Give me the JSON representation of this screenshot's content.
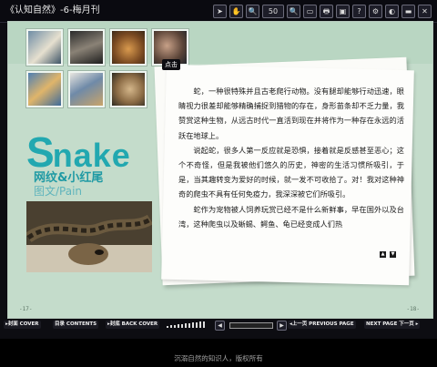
{
  "window": {
    "title": "《认知自然》-6-梅月刊"
  },
  "toolbar": {
    "zoom_label": "50"
  },
  "page": {
    "click_label": "点击",
    "heading_initial": "S",
    "heading_rest": "nake",
    "subtitle": "网纹&小红尾",
    "credit": "图文/Pain",
    "left_page_number": "-17-",
    "right_page_number": "-18-",
    "paragraphs": [
      "蛇，一种很特殊并且古老爬行动物。没有腿却能够行动迅速，眼睛视力很差却能够精确捕捉到猎物的存在，身形苗条却不乏力量，我赞赏这种生物，从远古时代一直活到现在并将作为一种存在永远的活跃在地球上。",
      "说起蛇，很多人第一反应就是恐惧，接着就是反感甚至恶心；这个不奇怪，但是我被他们悠久的历史，神密的生活习惯所吸引，于是，当其趣转变为爱好的时候，就一发不可收拾了。对！我对这种神奇的爬虫不具有任何免疫力，我深深被它们所吸引。",
      "蛇作为宠物被人饲养玩赏已经不是什么新鲜事，早在国外以及台湾，这种爬虫以及蜥蜴、鳄鱼、龟已经变成人们热"
    ]
  },
  "nav": {
    "cover_label": "▸封面 COVER",
    "contents_label": "目录 CONTENTS",
    "back_cover_label": "▸封底 BACK COVER",
    "prev_label": "◂上一页 PREVIOUS PAGE",
    "next_label": "NEXT PAGE 下一页 ▸"
  },
  "footer": {
    "copyright": "沉溺自然的知识人，版权所有"
  }
}
